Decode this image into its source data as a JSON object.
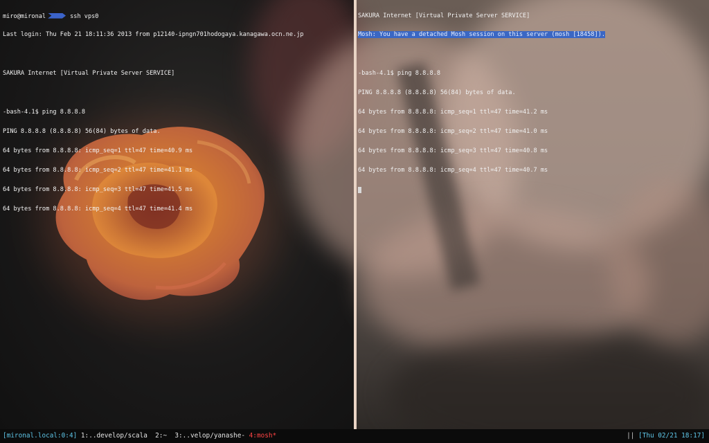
{
  "left_pane": {
    "prompt_user": "miro@mironal",
    "prompt_command": "ssh vps0",
    "lines": [
      "Last login: Thu Feb 21 18:11:36 2013 from p12140-ipngn701hodogaya.kanagawa.ocn.ne.jp",
      "",
      "SAKURA Internet [Virtual Private Server SERVICE]",
      "",
      "-bash-4.1$ ping 8.8.8.8",
      "PING 8.8.8.8 (8.8.8.8) 56(84) bytes of data.",
      "64 bytes from 8.8.8.8: icmp_seq=1 ttl=47 time=40.9 ms",
      "64 bytes from 8.8.8.8: icmp_seq=2 ttl=47 time=41.1 ms",
      "64 bytes from 8.8.8.8: icmp_seq=3 ttl=47 time=41.5 ms",
      "64 bytes from 8.8.8.8: icmp_seq=4 ttl=47 time=41.4 ms"
    ]
  },
  "right_pane": {
    "header": "SAKURA Internet [Virtual Private Server SERVICE]",
    "mosh_notice": "Mosh: You have a detached Mosh session on this server (mosh [18458]).",
    "lines": [
      "",
      "-bash-4.1$ ping 8.8.8.8",
      "PING 8.8.8.8 (8.8.8.8) 56(84) bytes of data.",
      "64 bytes from 8.8.8.8: icmp_seq=1 ttl=47 time=41.2 ms",
      "64 bytes from 8.8.8.8: icmp_seq=2 ttl=47 time=41.0 ms",
      "64 bytes from 8.8.8.8: icmp_seq=3 ttl=47 time=40.8 ms",
      "64 bytes from 8.8.8.8: icmp_seq=4 ttl=47 time=40.7 ms"
    ]
  },
  "statusbar": {
    "session": "[mironal.local:0:4]",
    "windows": [
      {
        "label": "1:..develop/scala",
        "active": false
      },
      {
        "label": "2:~",
        "active": false
      },
      {
        "label": "3:..velop/yanashe-",
        "active": false
      },
      {
        "label": "4:mosh*",
        "active": true
      }
    ],
    "right_sep": "||",
    "clock": "[Thu 02/21 18:17]"
  },
  "colors": {
    "prompt_arrow": "#3b63c9",
    "mosh_highlight": "#3a67c4",
    "status_session": "#5fc6e8",
    "status_active_window": "#ff4444"
  }
}
